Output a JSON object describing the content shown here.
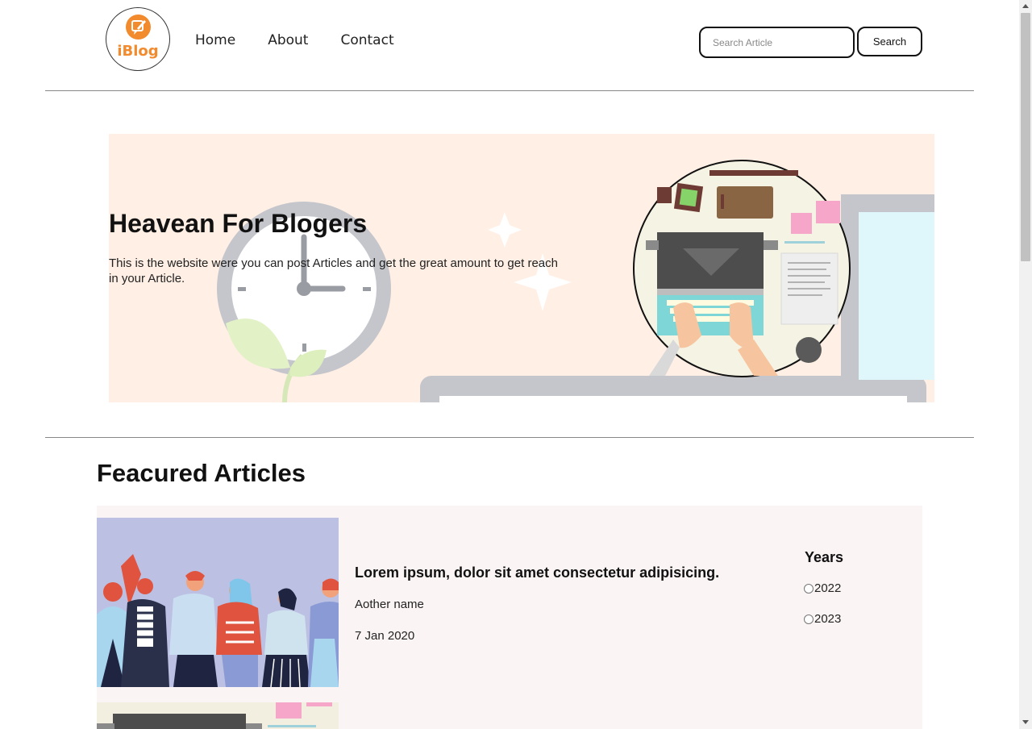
{
  "header": {
    "logo_text": "iBlog",
    "nav": [
      "Home",
      "About",
      "Contact"
    ],
    "search": {
      "placeholder": "Search Article",
      "value": "",
      "button_label": "Search"
    }
  },
  "hero": {
    "title": "Heavean For Blogers",
    "text": "This is the website were you can post Articles and get the great amount to get reach in your Article."
  },
  "featured": {
    "heading": "Feacured Articles",
    "articles": [
      {
        "title": "Lorem ipsum, dolor sit amet consectetur adipisicing.",
        "author": "Aother name",
        "date": "7 Jan 2020"
      }
    ],
    "years_title": "Years",
    "years": [
      "2022",
      "2023"
    ]
  },
  "colors": {
    "accent": "#f28a2e",
    "hero_bg": "#ffefe4",
    "panel_bg": "#faf5f4"
  },
  "icons": {
    "logo": "edit-bubble-icon"
  }
}
